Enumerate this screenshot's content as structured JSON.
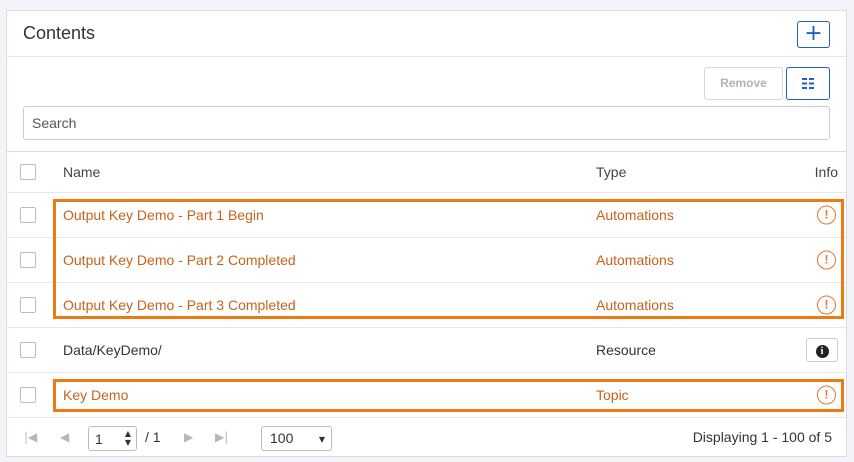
{
  "panel": {
    "title": "Contents",
    "add_label": "+"
  },
  "toolbar": {
    "remove_label": "Remove",
    "columns_icon": "list-columns-icon",
    "search_placeholder": "Search"
  },
  "table": {
    "headers": {
      "name": "Name",
      "type": "Type",
      "info": "Info"
    },
    "rows": [
      {
        "name": "Output Key Demo - Part 1 Begin",
        "type": "Automations",
        "info_icon": "warning-circle-icon",
        "status": "warning"
      },
      {
        "name": "Output Key Demo - Part 2 Completed",
        "type": "Automations",
        "info_icon": "warning-circle-icon",
        "status": "warning"
      },
      {
        "name": "Output Key Demo - Part 3 Completed",
        "type": "Automations",
        "info_icon": "warning-circle-icon",
        "status": "warning"
      },
      {
        "name": "Data/KeyDemo/",
        "type": "Resource",
        "info_icon": "info-icon",
        "status": "normal"
      },
      {
        "name": "Key Demo",
        "type": "Topic",
        "info_icon": "warning-circle-icon",
        "status": "warning"
      }
    ]
  },
  "footer": {
    "page_value": "1",
    "page_total": "/ 1",
    "page_size": "100",
    "display_text": "Displaying 1 - 100 of 5"
  },
  "colors": {
    "warning_text": "#c8621a",
    "highlight_border": "#f07a10",
    "primary": "#1f5fc7"
  }
}
